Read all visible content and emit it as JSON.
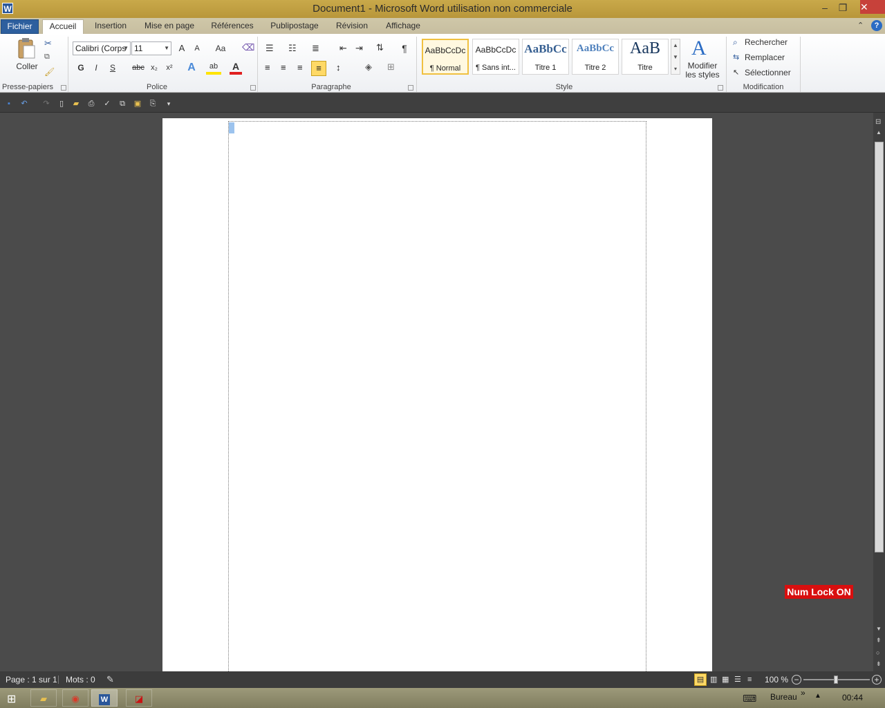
{
  "window": {
    "app_icon": "W",
    "title": "Document1 - Microsoft Word utilisation non commerciale",
    "minimize": "‒",
    "restore": "❐",
    "close": "✕"
  },
  "tabs": [
    {
      "label": "Fichier"
    },
    {
      "label": "Accueil"
    },
    {
      "label": "Insertion"
    },
    {
      "label": "Mise en page"
    },
    {
      "label": "Références"
    },
    {
      "label": "Publipostage"
    },
    {
      "label": "Révision"
    },
    {
      "label": "Affichage"
    }
  ],
  "ribbon": {
    "clipboard": {
      "group": "Presse-papiers",
      "paste": "Coller"
    },
    "font": {
      "group": "Police",
      "font_name": "Calibri (Corps",
      "font_size": "11",
      "grow": "A",
      "shrink": "A",
      "case": "Aa",
      "bold": "G",
      "italic": "I",
      "underline": "S",
      "strike": "abc",
      "subscript": "x₂",
      "superscript": "x²",
      "effects": "A",
      "highlight": "ab",
      "color": "A"
    },
    "paragraph": {
      "group": "Paragraphe",
      "pilcrow": "¶"
    },
    "styles": {
      "group": "Style",
      "items": [
        {
          "sample": "AaBbCcDc",
          "name": "¶ Normal"
        },
        {
          "sample": "AaBbCcDc",
          "name": "¶ Sans int..."
        },
        {
          "sample": "AaBbCc",
          "name": "Titre 1"
        },
        {
          "sample": "AaBbCc",
          "name": "Titre 2"
        },
        {
          "sample": "AaB",
          "name": "Titre"
        }
      ],
      "modify_line1": "Modifier",
      "modify_line2": "les styles"
    },
    "editing": {
      "group": "Modification",
      "find": "Rechercher",
      "replace": "Remplacer",
      "select": "Sélectionner"
    }
  },
  "document": {
    "numlock": "Num Lock ON"
  },
  "status": {
    "page": "Page : 1 sur 1",
    "words": "Mots : 0",
    "zoom": "100 %",
    "zoom_minus": "−",
    "zoom_plus": "+"
  },
  "taskbar": {
    "desktop": "Bureau",
    "chevron": "»",
    "time": "00:44",
    "word": "W"
  },
  "colors": {
    "title_bar": "#c9a94a",
    "file_tab": "#2d5f9e",
    "numlock_bg": "#d80f0f"
  }
}
